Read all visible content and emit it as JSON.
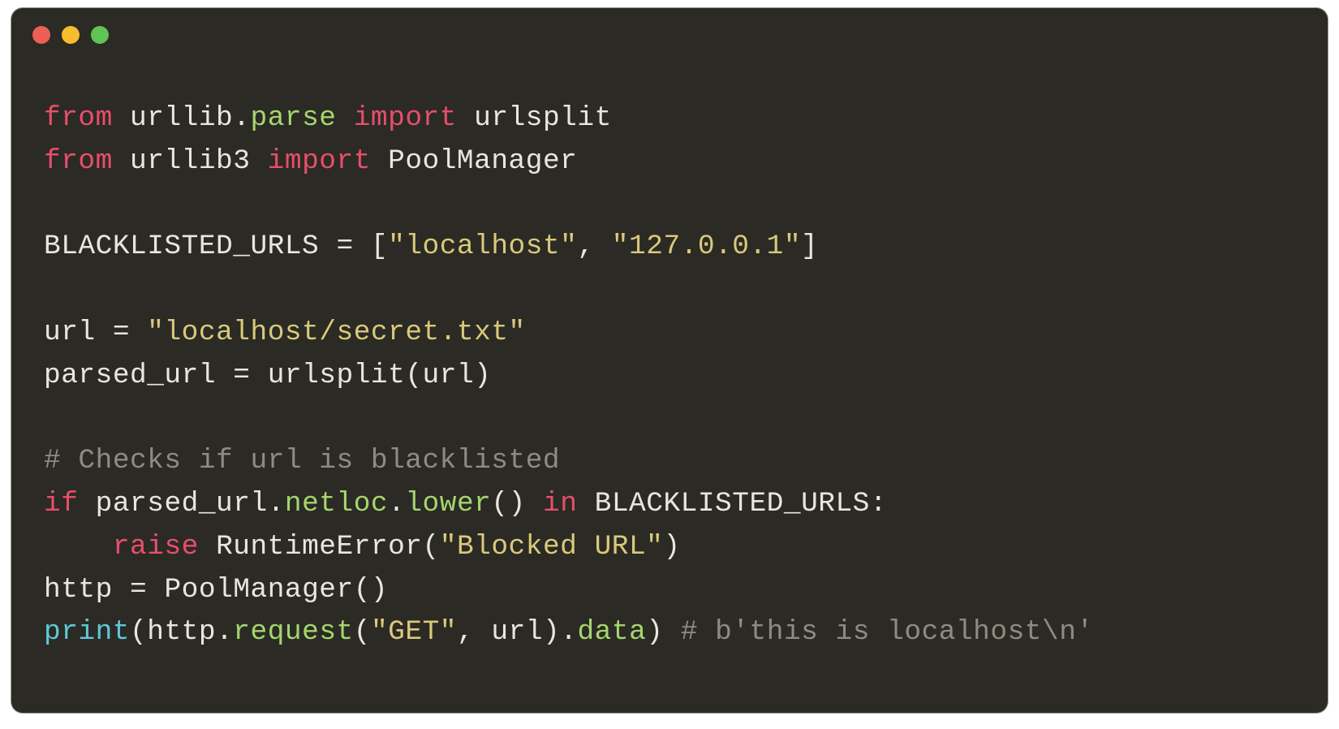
{
  "theme": {
    "background": "#2b2a25",
    "foreground": "#e8e6df",
    "keyword": "#e84e6a",
    "function": "#a4d66c",
    "builtin": "#5fc8d6",
    "string": "#d9c97a",
    "comment": "#8e8c80",
    "traffic_red": "#ec5f55",
    "traffic_yellow": "#f7bd2e",
    "traffic_green": "#5fc454"
  },
  "traffic_lights": [
    "close",
    "minimize",
    "zoom"
  ],
  "code_lines": [
    {
      "n": 1,
      "tokens": [
        {
          "t": "from ",
          "c": "kw"
        },
        {
          "t": "urllib",
          "c": "mod"
        },
        {
          "t": ".",
          "c": "op"
        },
        {
          "t": "parse",
          "c": "fn"
        },
        {
          "t": " import ",
          "c": "kw"
        },
        {
          "t": "urlsplit",
          "c": "mod"
        }
      ]
    },
    {
      "n": 2,
      "tokens": [
        {
          "t": "from ",
          "c": "kw"
        },
        {
          "t": "urllib3",
          "c": "mod"
        },
        {
          "t": " import ",
          "c": "kw"
        },
        {
          "t": "PoolManager",
          "c": "mod"
        }
      ]
    },
    {
      "n": 3,
      "tokens": []
    },
    {
      "n": 4,
      "tokens": [
        {
          "t": "BLACKLISTED_URLS ",
          "c": "mod"
        },
        {
          "t": "=",
          "c": "op"
        },
        {
          "t": " ",
          "c": "op"
        },
        {
          "t": "[",
          "c": "op"
        },
        {
          "t": "\"localhost\"",
          "c": "str"
        },
        {
          "t": ", ",
          "c": "op"
        },
        {
          "t": "\"127.0.0.1\"",
          "c": "str"
        },
        {
          "t": "]",
          "c": "op"
        }
      ]
    },
    {
      "n": 5,
      "tokens": []
    },
    {
      "n": 6,
      "tokens": [
        {
          "t": "url ",
          "c": "mod"
        },
        {
          "t": "=",
          "c": "op"
        },
        {
          "t": " ",
          "c": "op"
        },
        {
          "t": "\"localhost/secret.txt\"",
          "c": "str"
        }
      ]
    },
    {
      "n": 7,
      "tokens": [
        {
          "t": "parsed_url ",
          "c": "mod"
        },
        {
          "t": "=",
          "c": "op"
        },
        {
          "t": " ",
          "c": "op"
        },
        {
          "t": "urlsplit",
          "c": "mod"
        },
        {
          "t": "(",
          "c": "op"
        },
        {
          "t": "url",
          "c": "mod"
        },
        {
          "t": ")",
          "c": "op"
        }
      ]
    },
    {
      "n": 8,
      "tokens": []
    },
    {
      "n": 9,
      "tokens": [
        {
          "t": "# Checks if url is blacklisted",
          "c": "cmt"
        }
      ]
    },
    {
      "n": 10,
      "tokens": [
        {
          "t": "if ",
          "c": "kw"
        },
        {
          "t": "parsed_url",
          "c": "mod"
        },
        {
          "t": ".",
          "c": "op"
        },
        {
          "t": "netloc",
          "c": "fn"
        },
        {
          "t": ".",
          "c": "op"
        },
        {
          "t": "lower",
          "c": "fn"
        },
        {
          "t": "() ",
          "c": "op"
        },
        {
          "t": "in ",
          "c": "kw"
        },
        {
          "t": "BLACKLISTED_URLS",
          "c": "mod"
        },
        {
          "t": ":",
          "c": "op"
        }
      ]
    },
    {
      "n": 11,
      "tokens": [
        {
          "t": "    ",
          "c": "op"
        },
        {
          "t": "raise ",
          "c": "kw"
        },
        {
          "t": "RuntimeError",
          "c": "mod"
        },
        {
          "t": "(",
          "c": "op"
        },
        {
          "t": "\"Blocked URL\"",
          "c": "str"
        },
        {
          "t": ")",
          "c": "op"
        }
      ]
    },
    {
      "n": 12,
      "tokens": [
        {
          "t": "http ",
          "c": "mod"
        },
        {
          "t": "=",
          "c": "op"
        },
        {
          "t": " ",
          "c": "op"
        },
        {
          "t": "PoolManager",
          "c": "mod"
        },
        {
          "t": "()",
          "c": "op"
        }
      ]
    },
    {
      "n": 13,
      "tokens": [
        {
          "t": "print",
          "c": "call"
        },
        {
          "t": "(",
          "c": "op"
        },
        {
          "t": "http",
          "c": "mod"
        },
        {
          "t": ".",
          "c": "op"
        },
        {
          "t": "request",
          "c": "fn"
        },
        {
          "t": "(",
          "c": "op"
        },
        {
          "t": "\"GET\"",
          "c": "str"
        },
        {
          "t": ", ",
          "c": "op"
        },
        {
          "t": "url",
          "c": "mod"
        },
        {
          "t": ")",
          "c": "op"
        },
        {
          "t": ".",
          "c": "op"
        },
        {
          "t": "data",
          "c": "fn"
        },
        {
          "t": ") ",
          "c": "op"
        },
        {
          "t": "# b'this is localhost\\n'",
          "c": "cmt"
        }
      ]
    }
  ],
  "plain_source": "from urllib.parse import urlsplit\nfrom urllib3 import PoolManager\n\nBLACKLISTED_URLS = [\"localhost\", \"127.0.0.1\"]\n\nurl = \"localhost/secret.txt\"\nparsed_url = urlsplit(url)\n\n# Checks if url is blacklisted\nif parsed_url.netloc.lower() in BLACKLISTED_URLS:\n    raise RuntimeError(\"Blocked URL\")\nhttp = PoolManager()\nprint(http.request(\"GET\", url).data) # b'this is localhost\\n'"
}
